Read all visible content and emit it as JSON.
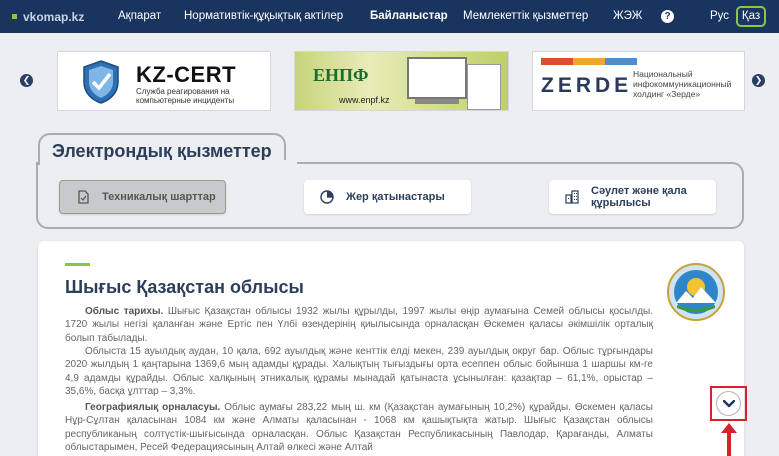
{
  "nav": {
    "brand": "vkomap.kz",
    "items": [
      "Ақпарат",
      "Нормативтік-құқықтық актілер",
      "Байланыстар",
      "Мемлекеттік қызметтер",
      "ЖЭЖ"
    ],
    "active_index": 2,
    "help_label": "?",
    "lang_ru": "Рус",
    "lang_kz": "Қаз"
  },
  "banners": {
    "kzcert": {
      "title": "KZ-CERT",
      "subtitle": "Служба реагирования на компьютерные инциденты"
    },
    "enpf": {
      "logo": "ЕНПФ",
      "url": "www.enpf.kz"
    },
    "zerde": {
      "title": "ZERDE",
      "subtitle": "Национальный инфокоммуникационный холдинг «Зерде»"
    }
  },
  "services": {
    "tab_title": "Электрондық қызметтер",
    "buttons": [
      {
        "label": "Техникалық шарттар",
        "icon": "document-icon",
        "disabled": true
      },
      {
        "label": "Жер қатынастары",
        "icon": "pie-chart-icon",
        "disabled": false
      },
      {
        "label": "Сәулет және қала құрылысы",
        "icon": "buildings-icon",
        "disabled": false
      }
    ]
  },
  "content": {
    "title": "Шығыс Қазақстан облысы",
    "p1_heading": "Облыс тарихы.",
    "p1_text": " Шығыс Қазақстан облысы 1932 жылы құрылды, 1997 жылы өңір аумағына Семей облысы қосылды. 1720 жылы негізі қаланған және Ертіс пен Үлбі өзендерінің қиылысында орналасқан Өскемен қаласы әкімшілік орталық болып табылады.",
    "p2_text": "Облыста 15 ауылдық аудан, 10 қала, 692 ауылдық және кенттік елді мекен, 239 ауылдық округ бар. Облыс тұрғындары 2020 жылдың 1 қаңтарына 1369,6 мың адамды құрады. Халықтың тығыздығы орта есеппен облыс бойынша 1 шаршы км-ге 4,9 адамды құрайды. Облыс халқының этникалық құрамы мынадай қатынаста ұсынылған: қазақтар – 61,1%, орыстар – 35,6%, басқа ұлттар – 3,3%.",
    "p3_heading": "Географиялық орналасуы.",
    "p3_text": " Облыс аумағы 283,22 мың ш. км (Қазақстан аумағының 10,2%) құрайды. Өскемен қаласы Нұр-Сұлтан қаласынан 1084 км және Алматы қаласынан - 1068 км қашықтықта жатыр. Шығыс Қазақстан облысы республиканың солтүстік-шығысында орналасқан. Облыс Қазақстан Республикасының Павлодар, Қарағанды, Алматы облыстарымен, Ресей Федерациясының Алтай өлкесі және Алтай"
  },
  "colors": {
    "nav_bg": "#19355f",
    "accent_green": "#8cc63f",
    "heading": "#2c3e5a",
    "highlight_red": "#d6232a"
  }
}
